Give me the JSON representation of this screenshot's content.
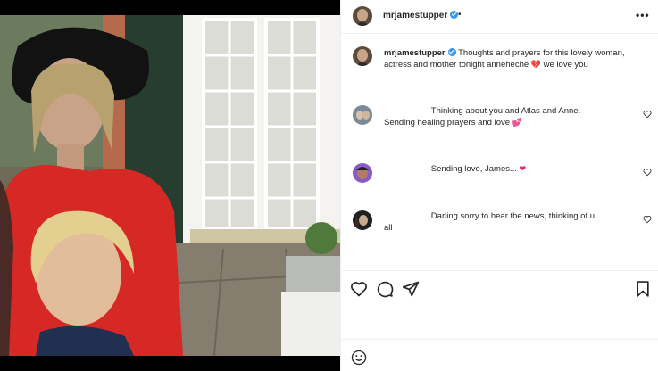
{
  "post": {
    "username": "mrjamestupper",
    "separator": "•"
  },
  "caption": {
    "username": "mrjamestupper",
    "text_before": "Thoughts and prayers for this lovely woman, actress and mother tonight anneheche",
    "emoji": "💔",
    "text_after": "we love you"
  },
  "comments": [
    {
      "text": "                    Thinking about you and Atlas and Anne.\nSending healing prayers and love",
      "emoji": "💕"
    },
    {
      "text": "                    Sending love, James...",
      "emoji": "❤"
    },
    {
      "text": "                    Darling sorry to hear the news, thinking of u\nall",
      "emoji": ""
    }
  ],
  "icons": {
    "more": "more-options-icon",
    "like": "heart-outline-icon",
    "comment": "speech-bubble-icon",
    "share": "paper-plane-icon",
    "save": "bookmark-icon",
    "emoji": "emoji-smiley-icon"
  },
  "colors": {
    "verified": "#3897f0",
    "text": "#262626",
    "divider": "#efefef"
  }
}
